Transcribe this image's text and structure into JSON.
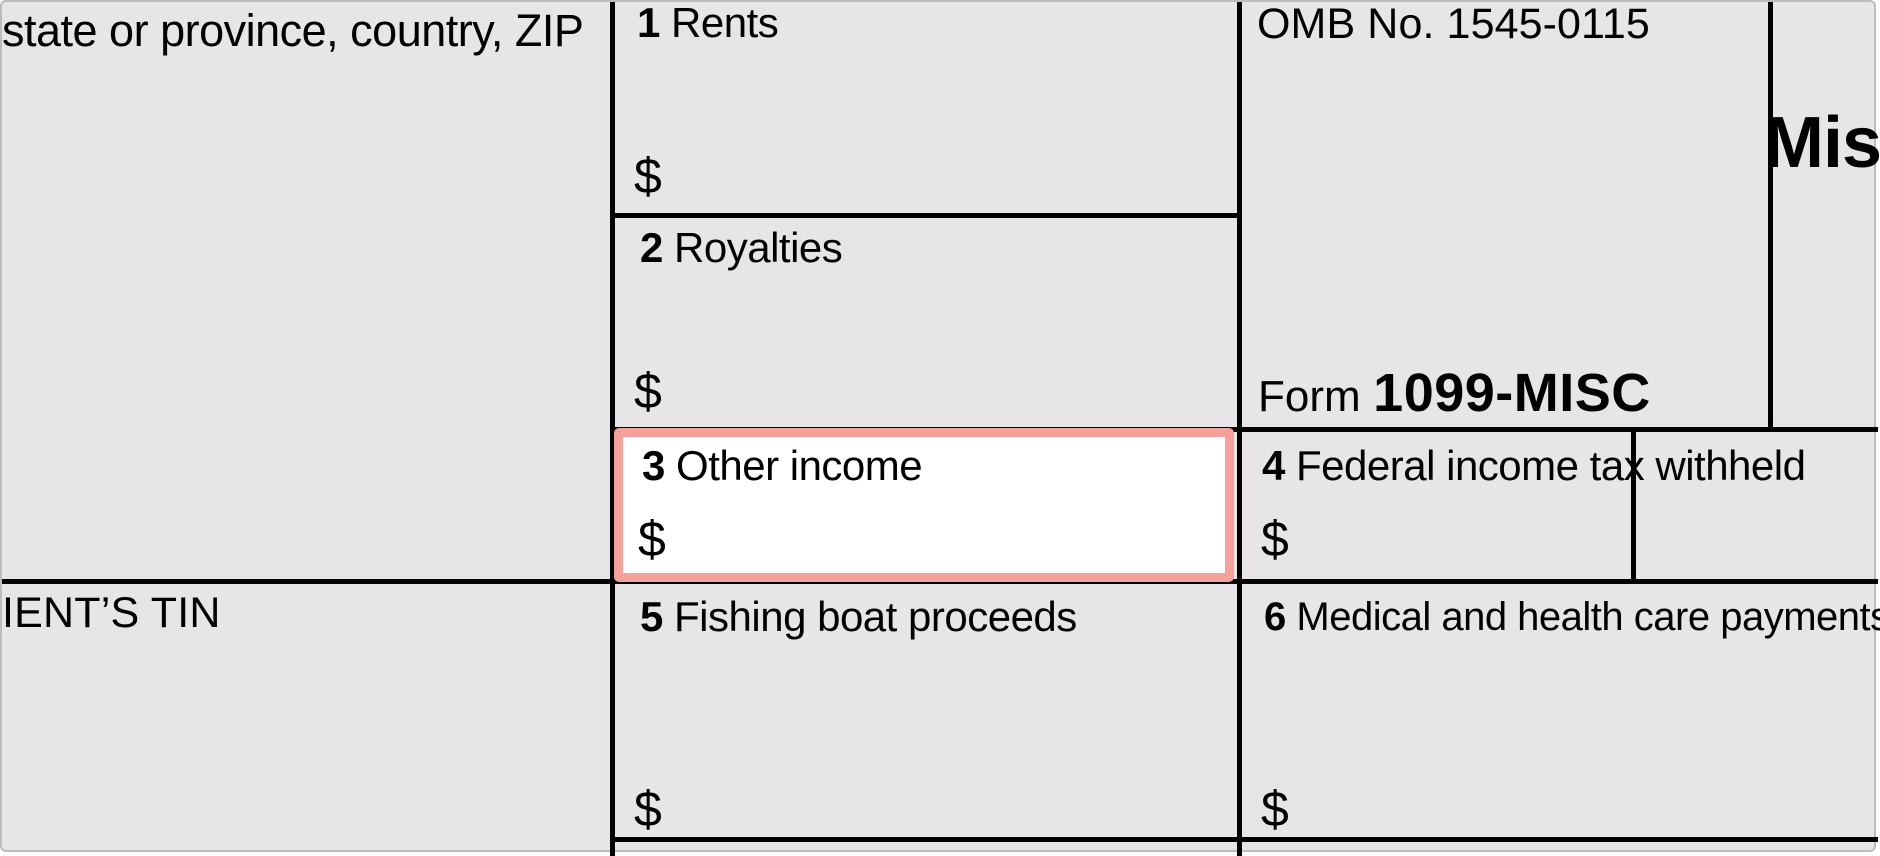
{
  "payer": {
    "address_hint": "state or province, country, ZIP"
  },
  "recipient": {
    "tin_label": "IENT’S TIN"
  },
  "header": {
    "omb": "OMB No. 1545-0115",
    "title_fragment": "Mis",
    "form_prefix": "Form",
    "form_name": "1099-MISC"
  },
  "boxes": {
    "b1": {
      "num": "1",
      "label": "Rents",
      "currency": "$"
    },
    "b2": {
      "num": "2",
      "label": "Royalties",
      "currency": "$"
    },
    "b3": {
      "num": "3",
      "label": "Other income",
      "currency": "$"
    },
    "b4": {
      "num": "4",
      "label": "Federal income tax withheld",
      "currency": "$"
    },
    "b5": {
      "num": "5",
      "label": "Fishing boat proceeds",
      "currency": "$"
    },
    "b6": {
      "num": "6",
      "label": "Medical and health care payments",
      "currency": "$"
    }
  }
}
